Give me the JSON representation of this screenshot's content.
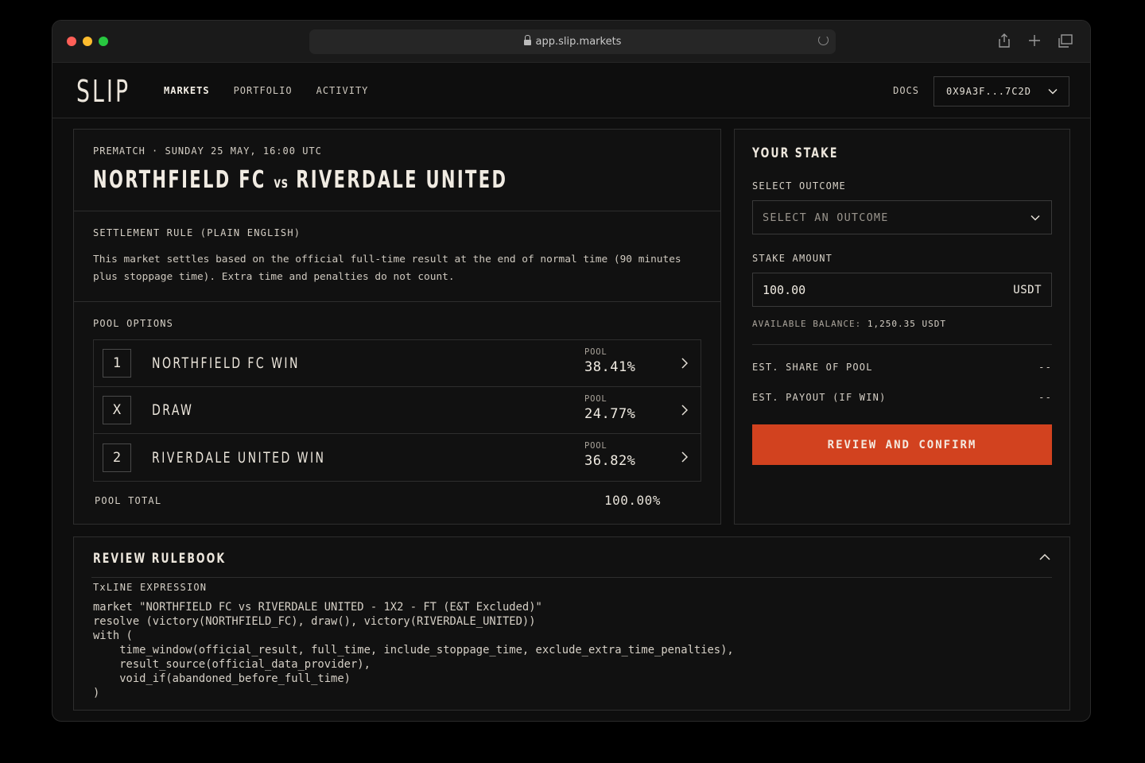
{
  "browser": {
    "url": "app.slip.markets"
  },
  "nav": {
    "logo": "SLIP",
    "items": [
      "MARKETS",
      "PORTFOLIO",
      "ACTIVITY"
    ],
    "active_item": "MARKETS",
    "docs": "DOCS",
    "wallet": "0X9A3F...7C2D"
  },
  "market": {
    "status": "PREMATCH · SUNDAY 25 MAY, 16:00 UTC",
    "home": "NORTHFIELD FC",
    "vs": "vs",
    "away": "RIVERDALE UNITED",
    "settlement_label": "SETTLEMENT RULE (PLAIN ENGLISH)",
    "settlement_text": "This market settles based on the official full-time result at the end of normal time (90 minutes plus stoppage time). Extra time and penalties do not count.",
    "pool_options_label": "POOL OPTIONS",
    "options": [
      {
        "key": "1",
        "name": "NORTHFIELD FC WIN",
        "pool_label": "POOL",
        "pool": "38.41%"
      },
      {
        "key": "X",
        "name": "DRAW",
        "pool_label": "POOL",
        "pool": "24.77%"
      },
      {
        "key": "2",
        "name": "RIVERDALE UNITED WIN",
        "pool_label": "POOL",
        "pool": "36.82%"
      }
    ],
    "pool_total_label": "POOL TOTAL",
    "pool_total": "100.00%"
  },
  "stake": {
    "title": "YOUR STAKE",
    "outcome_label": "SELECT OUTCOME",
    "outcome_placeholder": "SELECT AN OUTCOME",
    "amount_label": "STAKE AMOUNT",
    "amount": "100.00",
    "currency": "USDT",
    "balance_label": "AVAILABLE BALANCE:",
    "balance": "1,250.35 USDT",
    "share_label": "EST. SHARE OF POOL",
    "share_value": "--",
    "payout_label": "EST. PAYOUT (IF WIN)",
    "payout_value": "--",
    "confirm": "REVIEW AND CONFIRM",
    "accent": "#d2421f"
  },
  "rulebook": {
    "title": "REVIEW RULEBOOK",
    "expr_label": "TxLINE EXPRESSION",
    "code": "market \"NORTHFIELD FC vs RIVERDALE UNITED - 1X2 - FT (E&T Excluded)\"\nresolve (victory(NORTHFIELD_FC), draw(), victory(RIVERDALE_UNITED))\nwith (\n    time_window(official_result, full_time, include_stoppage_time, exclude_extra_time_penalties),\n    result_source(official_data_provider),\n    void_if(abandoned_before_full_time)\n)"
  }
}
